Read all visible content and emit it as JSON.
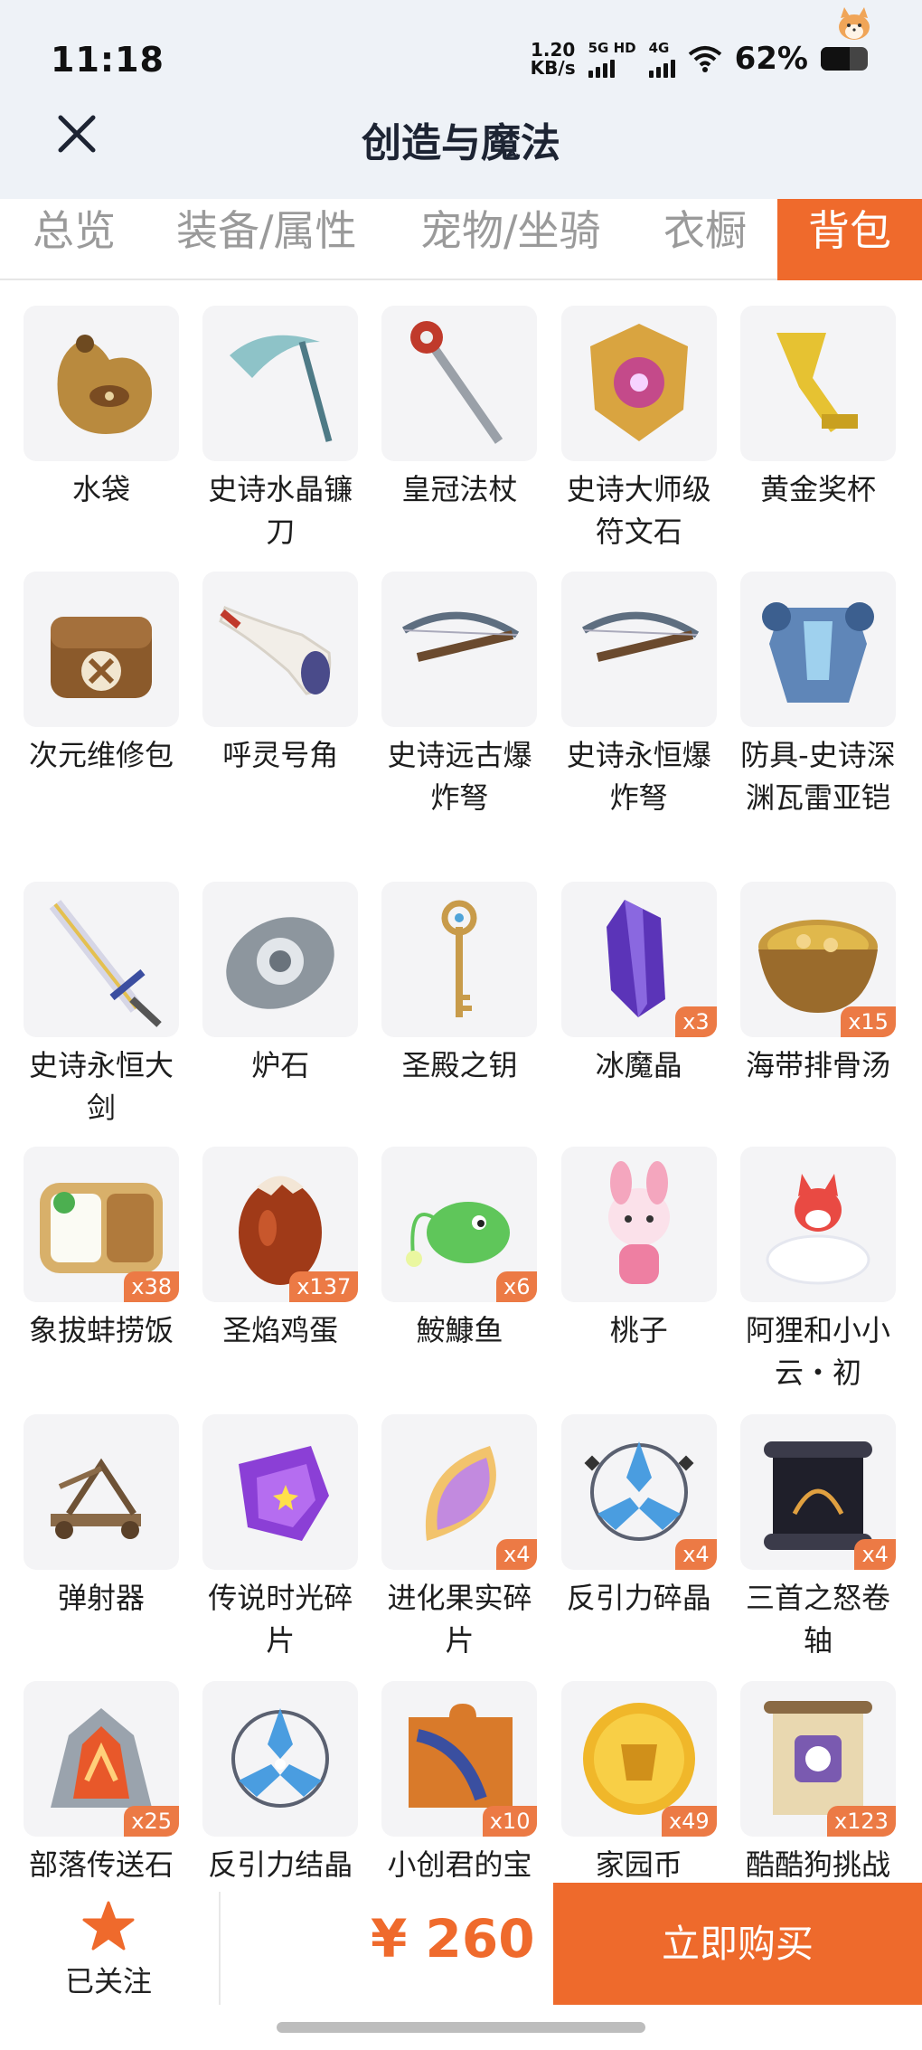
{
  "status_bar": {
    "time": "11:18",
    "speed_value": "1.20",
    "speed_unit": "KB/s",
    "network1": "5G HD",
    "network2": "4G",
    "battery": "62%",
    "battery_level": 0.62
  },
  "header": {
    "title": "创造与魔法",
    "close_icon": "close-icon"
  },
  "tabs": [
    {
      "label": "总览"
    },
    {
      "label": "装备/属性"
    },
    {
      "label": "宠物/坐骑"
    },
    {
      "label": "衣橱"
    },
    {
      "label": "背包",
      "active": true
    }
  ],
  "items": [
    {
      "name": "水袋",
      "qty": "",
      "icon": "waterskin-icon"
    },
    {
      "name": "史诗水晶镰刀",
      "qty": "",
      "icon": "scythe-icon"
    },
    {
      "name": "皇冠法杖",
      "qty": "",
      "icon": "crown-staff-icon"
    },
    {
      "name": "史诗大师级符文石",
      "qty": "",
      "icon": "rune-stone-icon"
    },
    {
      "name": "黄金奖杯",
      "qty": "",
      "icon": "golden-trophy-icon"
    },
    {
      "name": "次元维修包",
      "qty": "",
      "icon": "repair-bag-icon"
    },
    {
      "name": "呼灵号角",
      "qty": "",
      "icon": "horn-icon"
    },
    {
      "name": "史诗远古爆炸弩",
      "qty": "",
      "icon": "crossbow-icon"
    },
    {
      "name": "史诗永恒爆炸弩",
      "qty": "",
      "icon": "crossbow-icon"
    },
    {
      "name": "防具-史诗深渊瓦雷亚铠",
      "qty": "",
      "icon": "armor-icon"
    },
    {
      "name": "史诗永恒大剑",
      "qty": "",
      "icon": "greatsword-icon"
    },
    {
      "name": "炉石",
      "qty": "",
      "icon": "hearthstone-icon"
    },
    {
      "name": "圣殿之钥",
      "qty": "",
      "icon": "key-icon"
    },
    {
      "name": "冰魔晶",
      "qty": "x3",
      "icon": "crystal-icon"
    },
    {
      "name": "海带排骨汤",
      "qty": "x15",
      "icon": "soup-bowl-icon"
    },
    {
      "name": "象拔蚌捞饭",
      "qty": "x38",
      "icon": "bento-icon"
    },
    {
      "name": "圣焰鸡蛋",
      "qty": "x137",
      "icon": "egg-icon"
    },
    {
      "name": "鮟鱇鱼",
      "qty": "x6",
      "icon": "anglerfish-icon"
    },
    {
      "name": "桃子",
      "qty": "",
      "icon": "bunny-doll-icon"
    },
    {
      "name": "阿狸和小小云・初",
      "qty": "",
      "icon": "fox-cloud-icon"
    },
    {
      "name": "弹射器",
      "qty": "",
      "icon": "catapult-icon"
    },
    {
      "name": "传说时光碎片",
      "qty": "",
      "icon": "time-shard-icon"
    },
    {
      "name": "进化果实碎片",
      "qty": "x4",
      "icon": "fruit-slice-icon"
    },
    {
      "name": "反引力碎晶",
      "qty": "x4",
      "icon": "antigravity-shard-icon"
    },
    {
      "name": "三首之怒卷轴",
      "qty": "x4",
      "icon": "scroll-icon"
    },
    {
      "name": "部落传送石",
      "qty": "x25",
      "icon": "teleport-stone-icon"
    },
    {
      "name": "反引力结晶",
      "qty": "",
      "icon": "antigravity-crystal-icon"
    },
    {
      "name": "小创君的宝",
      "qty": "x10",
      "icon": "puzzle-piece-icon"
    },
    {
      "name": "家园币",
      "qty": "x49",
      "icon": "coin-icon"
    },
    {
      "name": "酷酷狗挑战",
      "qty": "x123",
      "icon": "wanted-poster-icon"
    }
  ],
  "bottom": {
    "follow_label": "已关注",
    "price": "¥ 260",
    "buy_label": "立即购买"
  },
  "colors": {
    "accent": "#ee6a2c",
    "tile_bg": "#f4f4f6"
  }
}
